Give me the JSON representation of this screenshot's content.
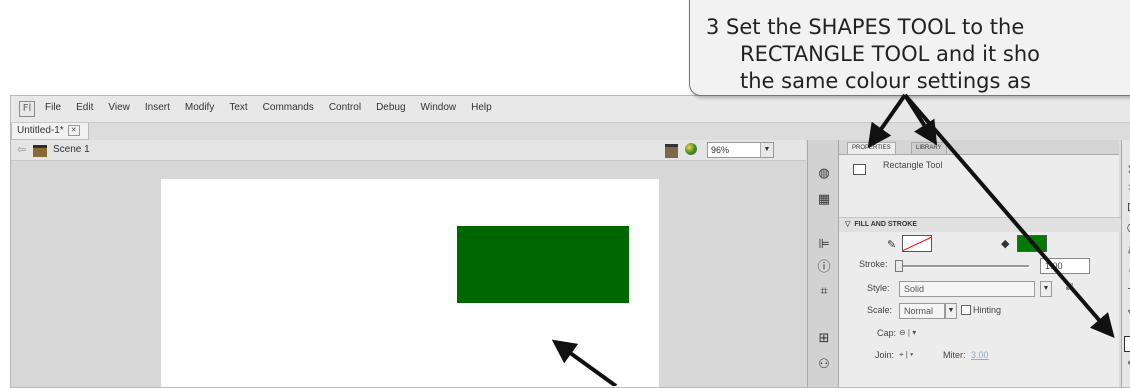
{
  "menubar": {
    "logo": "Fl",
    "items": [
      "File",
      "Edit",
      "View",
      "Insert",
      "Modify",
      "Text",
      "Commands",
      "Control",
      "Debug",
      "Window",
      "Help"
    ]
  },
  "document": {
    "tab_label": "Untitled-1*",
    "scene_label": "Scene 1",
    "zoom": "96%"
  },
  "stage": {
    "rectangle_color": "#006600",
    "background": "#ffffff"
  },
  "properties": {
    "tab_properties": "PROPERTIES",
    "tab_library": "LIBRARY",
    "tool_name": "Rectangle Tool",
    "section": "FILL AND STROKE",
    "stroke_label": "Stroke:",
    "stroke_value": "1.00",
    "style_label": "Style:",
    "style_value": "Solid",
    "scale_label": "Scale:",
    "scale_value": "Normal",
    "hinting_label": "Hinting",
    "cap_label": "Cap:",
    "join_label": "Join:",
    "miter_label": "Miter:",
    "miter_value": "3.00",
    "fill_color": "#007a00",
    "stroke_color": "#ff0000"
  },
  "callout": {
    "line1": "3  Set the SHAPES TOOL to the",
    "line2": "RECTANGLE TOOL and it sho",
    "line3": "the same colour settings as"
  }
}
